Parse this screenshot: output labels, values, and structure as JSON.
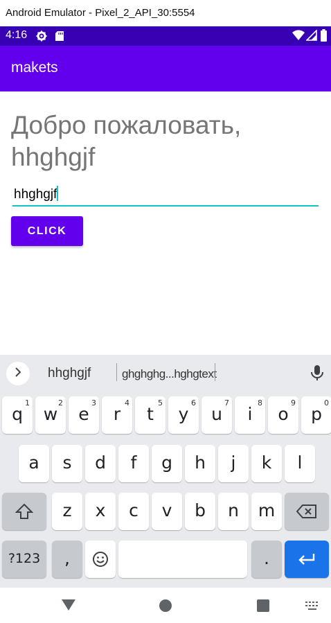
{
  "window": {
    "title": "Android Emulator - Pixel_2_API_30:5554"
  },
  "status_bar": {
    "time": "4:16",
    "colors": {
      "background": "#3700b3"
    }
  },
  "app_bar": {
    "title": "makets",
    "colors": {
      "background": "#6200ee"
    }
  },
  "content": {
    "welcome_text": "Добро пожаловать, hhghgjf",
    "input": {
      "value": "hhghgjf"
    },
    "click_button": {
      "label": "CLICK"
    }
  },
  "keyboard": {
    "suggestions": [
      "hhghgjf",
      "ghghghg...hghgtext"
    ],
    "rows": [
      [
        {
          "label": "q",
          "hint": "1"
        },
        {
          "label": "w",
          "hint": "2"
        },
        {
          "label": "e",
          "hint": "3"
        },
        {
          "label": "r",
          "hint": "4"
        },
        {
          "label": "t",
          "hint": "5"
        },
        {
          "label": "y",
          "hint": "6"
        },
        {
          "label": "u",
          "hint": "7"
        },
        {
          "label": "i",
          "hint": "8"
        },
        {
          "label": "o",
          "hint": "9"
        },
        {
          "label": "p",
          "hint": "0"
        }
      ],
      [
        {
          "label": "a"
        },
        {
          "label": "s"
        },
        {
          "label": "d"
        },
        {
          "label": "f"
        },
        {
          "label": "g"
        },
        {
          "label": "h"
        },
        {
          "label": "j"
        },
        {
          "label": "k"
        },
        {
          "label": "l"
        }
      ],
      [
        {
          "label": "z"
        },
        {
          "label": "x"
        },
        {
          "label": "c"
        },
        {
          "label": "v"
        },
        {
          "label": "b"
        },
        {
          "label": "n"
        },
        {
          "label": "m"
        }
      ]
    ],
    "symbols_key": "?123",
    "comma_key": ",",
    "period_key": ".",
    "colors": {
      "background": "#e8eaed",
      "enter": "#1a73e8"
    }
  }
}
